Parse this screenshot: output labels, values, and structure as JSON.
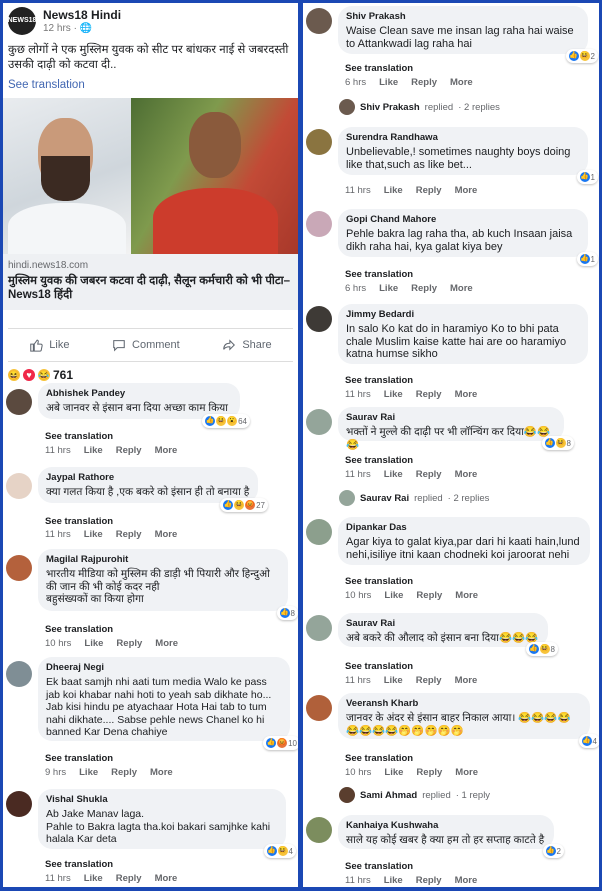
{
  "post": {
    "page_name": "News18 Hindi",
    "logo_text": "NEWS18",
    "time": "12 hrs",
    "text": "कुछ लोगों ने एक मुस्लिम युवक को सीट पर बांधकर नाई से जबरदस्ती उसकी दाढ़ी को कटवा दी..",
    "see_translation": "See translation",
    "link_domain": "hindi.news18.com",
    "link_title": "मुस्लिम युवक की जबरन कटवा दी दाढ़ी, सैलून कर्मचारी को भी पीटा– News18 हिंदी",
    "actions": {
      "like": "Like",
      "comment": "Comment",
      "share": "Share"
    },
    "reaction_count": "761"
  },
  "labels": {
    "see_translation": "See translation",
    "like": "Like",
    "reply": "Reply",
    "more": "More",
    "replied": "replied"
  },
  "left_comments": [
    {
      "name": "Abhishek Pandey",
      "text": "अबे जानवर से इंसान बना दिया अच्छा काम किया",
      "time": "11 hrs",
      "count": "64"
    },
    {
      "name": "Jaypal Rathore",
      "text": "क्या गलत किया है ,एक बकरे को इंसान ही तो बनाया है",
      "time": "11 hrs",
      "count": "27"
    },
    {
      "name": "Magilal Rajpurohit",
      "text": "भारतीय मीडिया को मुस्लिम की डाड़ी भी पियारी और हिन्दुओ की जान की भी कोई कदर नही\nबहुसंख्यकों का किया होगा",
      "time": "10 hrs",
      "count": "8"
    },
    {
      "name": "Dheeraj Negi",
      "text": "Ek baat samjh nhi aati tum media Walo ke pass jab koi khabar nahi hoti to yeah sab dikhate ho... Jab kisi hindu pe atyachaar Hota Hai tab to tum nahi dikhate.... Sabse pehle news Chanel ko hi banned Kar Dena chahiye",
      "time": "9 hrs",
      "count": "10"
    },
    {
      "name": "Vishal Shukla",
      "text": "Ab Jake Manav laga.\nPahle to Bakra lagta tha.koi bakari samjhke kahi halala Kar deta",
      "time": "11 hrs",
      "count": "4"
    }
  ],
  "right_comments": [
    {
      "name": "Shiv Prakash",
      "text": "Waise Clean save me insan lag raha hai waise to Attankwadi lag raha hai",
      "time": "6 hrs",
      "count": "2"
    },
    {
      "name": "Surendra Randhawa",
      "text": "Unbelievable,! sometimes naughty boys doing like that,such as like bet...",
      "time": "11 hrs",
      "count": "1"
    },
    {
      "name": "Gopi Chand Mahore",
      "text": "Pehle bakra lag raha tha, ab kuch Insaan jaisa dikh raha hai, kya galat kiya bey",
      "time": "6 hrs",
      "count": "1"
    },
    {
      "name": "Jimmy Bedardi",
      "text": "In salo Ko kat do in haramiyo Ko to bhi pata chale Muslim kaise katte hai are oo haramiyo katna humse sikho",
      "time": "11 hrs",
      "count": ""
    },
    {
      "name": "Saurav Rai",
      "text": "भक्तों ने मुल्ले की दाढ़ी पर भी लॉन्चिंग कर दिया😂😂😂",
      "time": "11 hrs",
      "count": "8"
    },
    {
      "name": "Dipankar Das",
      "text": "Agar kiya to galat kiya,par dari hi kaati hain,lund nehi,isiliye itni kaan chodneki koi jaroorat nehi",
      "time": "10 hrs",
      "count": ""
    },
    {
      "name": "Saurav Rai",
      "text": "अबे बकरे की औलाद को इंसान बना दिया😂😂😂",
      "time": "11 hrs",
      "count": "8"
    },
    {
      "name": "Veeransh Kharb",
      "text": "जानवर के अंदर से इंसान बाहर निकाल आया। 😂😂😂😂\n😂😂😂😂🤭🤭🤭🤭🤭",
      "time": "10 hrs",
      "count": "4"
    },
    {
      "name": "Kanhaiya Kushwaha",
      "text": "साले यह कोई खबर है क्या हम तो हर सप्ताह काटते है",
      "time": "11 hrs",
      "count": "2"
    }
  ],
  "replies": [
    {
      "name": "Shiv Prakash",
      "count": "2 replies"
    },
    {
      "name": "Saurav Rai",
      "count": "2 replies"
    },
    {
      "name": "Sami Ahmad",
      "count": "1 reply"
    }
  ],
  "colors": {
    "background": "#1b48b4",
    "link": "#4267b2",
    "bubble": "#f0f2f5",
    "like": "#1877f2",
    "haha": "#f7c33b",
    "love": "#f02849"
  }
}
